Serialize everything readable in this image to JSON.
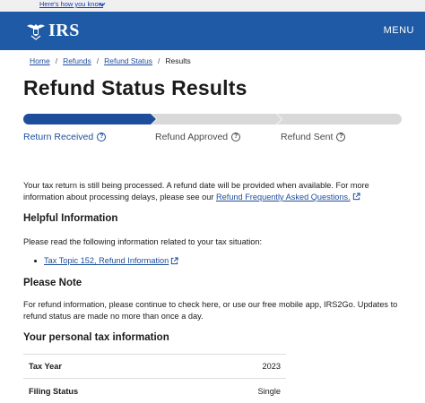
{
  "banner": {
    "link_text": "Here's how you know"
  },
  "header": {
    "logo_text": "IRS",
    "menu_label": "MENU"
  },
  "breadcrumb": {
    "items": [
      "Home",
      "Refunds",
      "Refund Status"
    ],
    "current": "Results",
    "separator": "/"
  },
  "page": {
    "title": "Refund Status Results"
  },
  "progress": {
    "steps": [
      {
        "label": "Return Received",
        "state": "complete"
      },
      {
        "label": "Refund Approved",
        "state": "pending"
      },
      {
        "label": "Refund Sent",
        "state": "pending"
      }
    ],
    "help_glyph": "?",
    "active_color": "#1e4d9b",
    "inactive_color": "#d9d9d9"
  },
  "status": {
    "text_before": "Your tax return is still being processed. A refund date will be provided when available. For more information about processing delays, please see our ",
    "link_text": "Refund Frequently Asked Questions."
  },
  "helpful": {
    "heading": "Helpful Information",
    "intro": "Please read the following information related to your tax situation:",
    "links": [
      "Tax Topic 152, Refund Information"
    ]
  },
  "note": {
    "heading": "Please Note",
    "text": "For refund information, please continue to check here, or use our free mobile app, IRS2Go. Updates to refund status are made no more than once a day."
  },
  "personal": {
    "heading": "Your personal tax information",
    "rows": [
      {
        "label": "Tax Year",
        "value": "2023"
      },
      {
        "label": "Filing Status",
        "value": "Single"
      }
    ]
  },
  "colors": {
    "header_bg": "#1e5aa5",
    "link": "#1e4d9b"
  }
}
